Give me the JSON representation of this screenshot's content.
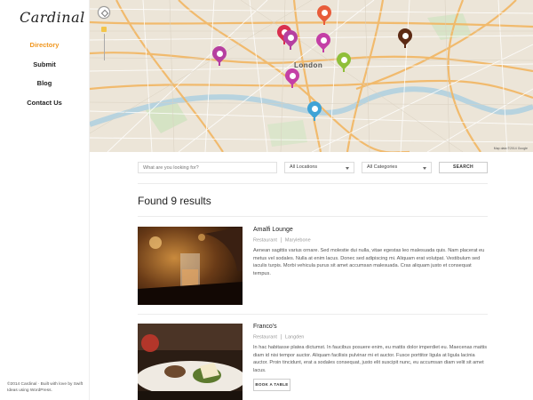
{
  "sidebar": {
    "logo": "Cardinal",
    "nav": [
      {
        "label": "Directory",
        "active": true
      },
      {
        "label": "Submit",
        "active": false
      },
      {
        "label": "Blog",
        "active": false
      },
      {
        "label": "Contact Us",
        "active": false
      }
    ],
    "footer": "©2014 Cardinal · Built with love by Swift Ideas using WordPress."
  },
  "map": {
    "city_label": "London",
    "credit": "Map data ©2014 Google",
    "pin_colors": [
      "#e85c3a",
      "#d92f4f",
      "#b63fa0",
      "#c43fa6",
      "#5c2a14",
      "#b63fa0",
      "#8fbf3a",
      "#c43fa6",
      "#3fa3d6"
    ],
    "accent": "#f0961e"
  },
  "search": {
    "placeholder": "What are you looking for?",
    "location": "All Locations",
    "category": "All Categories",
    "button": "SEARCH"
  },
  "results": {
    "title": "Found 9 results",
    "items": [
      {
        "name": "Amalfi Lounge",
        "category": "Restaurant",
        "area": "Marylebone",
        "description": "Aenean sagittis varius ornare. Sed molestie dui nulla, vitae egestas leo malesuada quis. Nam placerat eu metus vel sodales. Nulla at enim lacus. Donec sed adipiscing mi. Aliquam erat volutpat. Vestibulum sed iaculis turpis. Morbi vehicula purus sit amet accumsan malesuada. Cras aliquam justo et consequat tempus."
      },
      {
        "name": "Franco's",
        "category": "Restaurant",
        "area": "Langden",
        "description": "In hac habitasse platea dictumst. In faucibus posuere enim, eu mattis dolor imperdiet eu. Maecenas mattis diam id nisi tempor auctor. Aliquam facilisis pulvinar mi et auctor. Fusce porttitor ligula at ligula lacinia auctor. Proin tincidunt, erat a sodales consequat, justo elit suscipit nunc, eu accumsan diam velit sit amet lacus.",
        "book_button": "BOOK A TABLE"
      }
    ]
  }
}
